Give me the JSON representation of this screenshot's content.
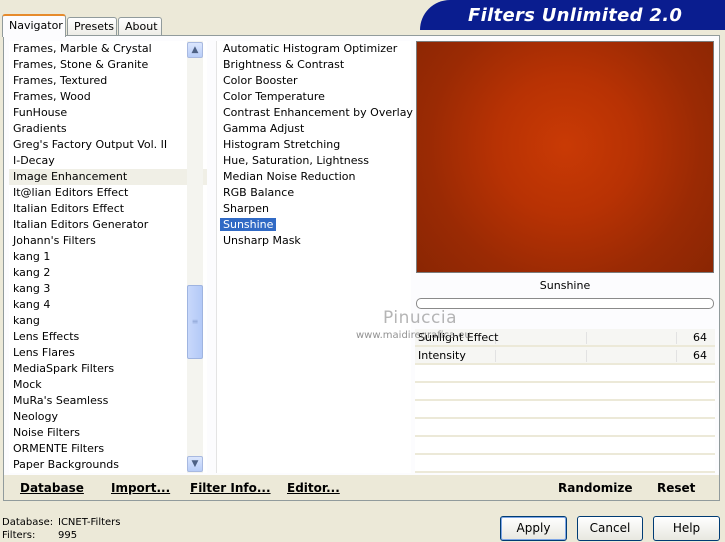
{
  "tabs": [
    {
      "label": "Navigator",
      "active": true
    },
    {
      "label": "Presets",
      "active": false
    },
    {
      "label": "About",
      "active": false
    }
  ],
  "app_title": "Filters Unlimited 2.0",
  "categories": {
    "items": [
      "Frames, Marble & Crystal",
      "Frames, Stone & Granite",
      "Frames, Textured",
      "Frames, Wood",
      "FunHouse",
      "Gradients",
      "Greg's Factory Output Vol. II",
      "I-Decay",
      "Image Enhancement",
      "It@lian Editors Effect",
      "Italian Editors Effect",
      "Italian Editors Generator",
      "Johann's Filters",
      "kang 1",
      "kang 2",
      "kang 3",
      "kang 4",
      "kang",
      "Lens Effects",
      "Lens Flares",
      "MediaSpark Filters",
      "Mock",
      "MuRa's Seamless",
      "Neology",
      "Noise Filters",
      "ORMENTE Filters",
      "Paper Backgrounds"
    ],
    "selected": "Image Enhancement"
  },
  "filters": {
    "items": [
      "Automatic Histogram Optimizer",
      "Brightness & Contrast",
      "Color Booster",
      "Color Temperature",
      "Contrast Enhancement by Overlay",
      "Gamma Adjust",
      "Histogram Stretching",
      "Hue, Saturation, Lightness",
      "Median Noise Reduction",
      "RGB Balance",
      "Sharpen",
      "Sunshine",
      "Unsharp Mask"
    ],
    "selected": "Sunshine"
  },
  "preview": {
    "caption": "Sunshine",
    "color": "#b83204"
  },
  "params": [
    {
      "name": "Sunlight Effect",
      "value": "64"
    },
    {
      "name": "Intensity",
      "value": "64"
    }
  ],
  "watermark": {
    "line1": "Pinuccia",
    "line2": "www.maidiregrafica.eu"
  },
  "panel_links": {
    "database": "Database",
    "import": "Import...",
    "filter_info": "Filter Info...",
    "editor": "Editor...",
    "randomize": "Randomize",
    "reset": "Reset"
  },
  "status": {
    "database_label": "Database:",
    "database_value": "ICNET-Filters",
    "filters_label": "Filters:",
    "filters_value": "995"
  },
  "buttons": {
    "apply": "Apply",
    "cancel": "Cancel",
    "help": "Help"
  },
  "icons": {
    "scroll_up": "chevron-up-icon",
    "scroll_down": "chevron-down-icon"
  }
}
